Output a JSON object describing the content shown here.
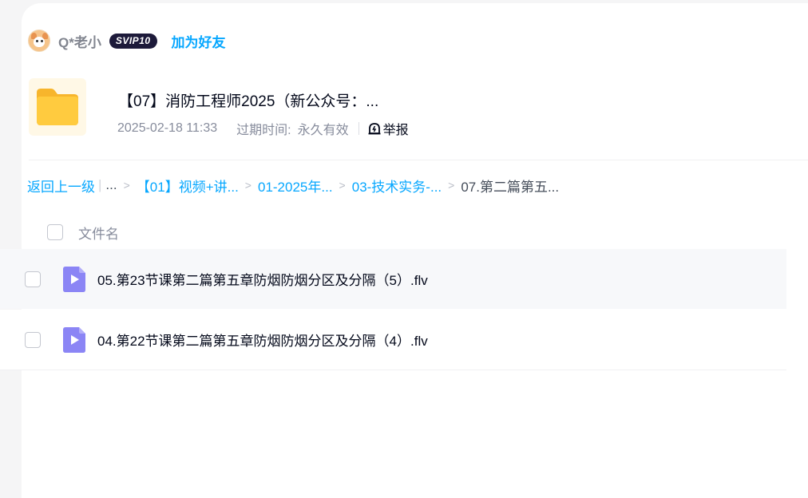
{
  "sharer": {
    "name": "Q*老小",
    "vip_badge": "SVIP10",
    "add_friend": "加为好友"
  },
  "folder": {
    "title": "【07】消防工程师2025（新公众号：...",
    "date": "2025-02-18 11:33",
    "expire_label": "过期时间:",
    "expire_value": "永久有效",
    "report": "举报",
    "icon": "folder-icon"
  },
  "breadcrumb": {
    "back": "返回上一级",
    "ellipsis": "...",
    "items": [
      "【01】视频+讲...",
      "01-2025年...",
      "03-技术实务-..."
    ],
    "current": "07.第二篇第五..."
  },
  "table": {
    "header": "文件名",
    "rows": [
      {
        "name": "05.第23节课第二篇第五章防烟防烟分区及分隔（5）.flv",
        "icon": "video-file-icon"
      },
      {
        "name": "04.第22节课第二篇第五章防烟防烟分区及分隔（4）.flv",
        "icon": "video-file-icon"
      }
    ]
  },
  "colors": {
    "link": "#06a7ff",
    "primary_text": "#03081a",
    "secondary_text": "#878c9c",
    "folder": "#ffc93c",
    "video_icon": "#8b85f5"
  }
}
